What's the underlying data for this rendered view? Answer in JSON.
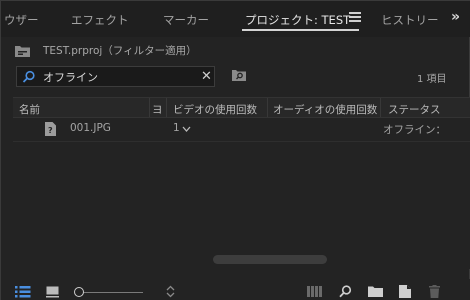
{
  "tabs": [
    {
      "label": "ウザー",
      "active": false
    },
    {
      "label": "エフェクト",
      "active": false
    },
    {
      "label": "マーカー",
      "active": false
    },
    {
      "label": "プロジェクト: TEST",
      "active": true
    },
    {
      "label": "ヒストリー",
      "active": false
    }
  ],
  "overflow_label": "»",
  "project": {
    "name": "TEST.prproj（フィルター適用）"
  },
  "search": {
    "value": "オフライン",
    "clear_label": "✕"
  },
  "item_count": "1 項目",
  "table": {
    "headers": [
      "名前",
      "ヨ",
      "ビデオの使用回数",
      "オーディオの使用回数",
      "ステータス"
    ],
    "rows": [
      {
        "name": "001.JPG",
        "video_usage": "1",
        "status": "オフライン："
      }
    ]
  },
  "colors": {
    "background": "#232323",
    "tab_active": "#e6e6e6",
    "accent_blue": "#4a8fe0"
  }
}
